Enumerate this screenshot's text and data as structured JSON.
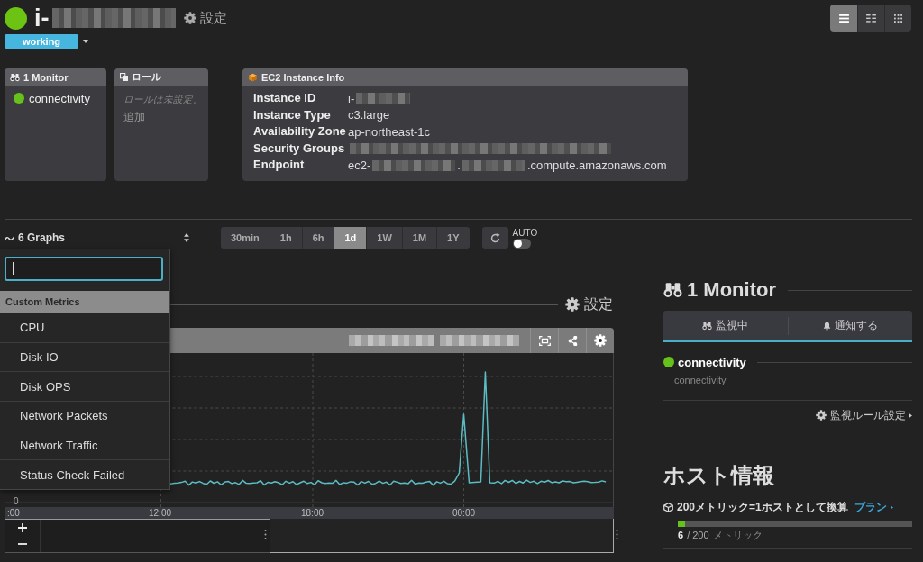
{
  "host": {
    "name_parts": [
      {
        "kind": "text",
        "text": "i-"
      },
      {
        "kind": "redacted"
      }
    ],
    "settings_label": "設定",
    "status_label": "working"
  },
  "view_modes": [
    {
      "kind": "list",
      "selected": true
    },
    {
      "kind": "columns",
      "selected": false
    },
    {
      "kind": "tiles",
      "selected": false
    }
  ],
  "panels": {
    "monitors": {
      "title": "1 Monitor",
      "items": [
        {
          "name": "connectivity",
          "color": "#66c21a"
        }
      ]
    },
    "roles": {
      "title": "ロール",
      "empty_text": "ロールは未設定。",
      "add_link": "追加"
    },
    "ec2_info": {
      "title": "EC2 Instance Info",
      "rows": [
        {
          "label": "Instance ID",
          "value_parts": [
            {
              "kind": "text",
              "text": "i-"
            },
            {
              "kind": "redacted"
            }
          ]
        },
        {
          "label": "Instance Type",
          "value_parts": [
            {
              "kind": "text",
              "text": "c3.large"
            }
          ]
        },
        {
          "label": "Availability Zone",
          "value_parts": [
            {
              "kind": "text",
              "text": "ap-northeast-1c"
            }
          ]
        },
        {
          "label": "Security Groups",
          "value_parts": [
            {
              "kind": "redacted"
            }
          ]
        },
        {
          "label": "Endpoint",
          "value_parts": [
            {
              "kind": "text",
              "text": "ec2-"
            },
            {
              "kind": "redacted"
            },
            {
              "kind": "text",
              "text": "."
            },
            {
              "kind": "redacted"
            },
            {
              "kind": "text",
              "text": ".compute.amazonaws.com"
            }
          ]
        }
      ]
    }
  },
  "toolbar": {
    "graphs_label": "6 Graphs",
    "time_ranges": [
      {
        "label": "30min",
        "selected": false
      },
      {
        "label": "1h",
        "selected": false
      },
      {
        "label": "6h",
        "selected": false
      },
      {
        "label": "1d",
        "selected": true
      },
      {
        "label": "1W",
        "selected": false
      },
      {
        "label": "1M",
        "selected": false
      },
      {
        "label": "1Y",
        "selected": false
      }
    ],
    "auto_refresh": {
      "label": "AUTO",
      "on": false
    }
  },
  "graph_menu": {
    "search": {
      "focused": true
    },
    "group": "Custom Metrics",
    "items": [
      "CPU",
      "Disk IO",
      "Disk OPS",
      "Network Packets",
      "Network Traffic",
      "Status Check Failed"
    ]
  },
  "graphs_section": {
    "settings_label": "設定",
    "graph": {
      "title_parts": [
        {
          "kind": "redacted"
        },
        {
          "kind": "redacted"
        }
      ],
      "y_label": "0",
      "x_labels": [
        ":00",
        "12:00",
        "18:00",
        "00:00"
      ]
    }
  },
  "monitors_section": {
    "title": "1 Monitor",
    "tabs": [
      {
        "kind": "monitoring",
        "label": "監視中"
      },
      {
        "kind": "notifications",
        "label": "通知する"
      }
    ],
    "monitors": [
      {
        "name": "connectivity",
        "description": "connectivity",
        "color": "#66c21a"
      }
    ],
    "rules_link": "監視ルール設定"
  },
  "host_info": {
    "title": "ホスト情報",
    "plan_note": "200メトリック=1ホストとして換算",
    "plan_link": "プラン",
    "usage": {
      "level": 0.03,
      "count": "6",
      "total": "/ 200",
      "unit": "メトリック"
    }
  }
}
